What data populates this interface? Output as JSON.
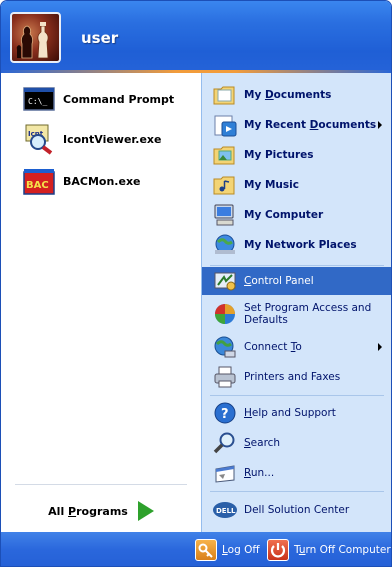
{
  "header": {
    "username": "user"
  },
  "pinned": [
    {
      "label": "Command Prompt",
      "icon": "command-prompt-icon"
    },
    {
      "label": "IcontViewer.exe",
      "icon": "icontviewer-icon"
    },
    {
      "label": "BACMon.exe",
      "icon": "bacmon-icon"
    }
  ],
  "all_programs": {
    "label_pre": "All ",
    "label_u": "P",
    "label_post": "rograms"
  },
  "places": [
    {
      "pre": "My ",
      "u": "D",
      "post": "ocuments",
      "icon": "my-documents-icon",
      "bold": true
    },
    {
      "pre": "My Recent ",
      "u": "D",
      "post": "ocuments",
      "icon": "recent-documents-icon",
      "bold": true,
      "submenu": true
    },
    {
      "pre": "My Pictures",
      "u": "",
      "post": "",
      "icon": "my-pictures-icon",
      "bold": true
    },
    {
      "pre": "My Music",
      "u": "",
      "post": "",
      "icon": "my-music-icon",
      "bold": true
    },
    {
      "pre": "My Computer",
      "u": "",
      "post": "",
      "icon": "my-computer-icon",
      "bold": true
    },
    {
      "pre": "My Network Places",
      "u": "",
      "post": "",
      "icon": "network-places-icon",
      "bold": true
    }
  ],
  "system": [
    {
      "pre": "",
      "u": "C",
      "post": "ontrol Panel",
      "icon": "control-panel-icon",
      "selected": true
    },
    {
      "line1": "Set Program Access and",
      "line2": "Defaults",
      "icon": "program-access-icon"
    },
    {
      "pre": "Connect ",
      "u": "T",
      "post": "o",
      "icon": "connect-to-icon",
      "submenu": true
    },
    {
      "pre": "Printers and Faxes",
      "u": "",
      "post": "",
      "icon": "printers-icon"
    }
  ],
  "help": [
    {
      "pre": "",
      "u": "H",
      "post": "elp and Support",
      "icon": "help-icon"
    },
    {
      "pre": "",
      "u": "S",
      "post": "earch",
      "icon": "search-icon"
    },
    {
      "pre": "",
      "u": "R",
      "post": "un...",
      "icon": "run-icon"
    }
  ],
  "extra": {
    "label": "Dell Solution Center",
    "icon_text": "DELL"
  },
  "footer": {
    "logoff": {
      "pre": "",
      "u": "L",
      "post": "og Off"
    },
    "turnoff": {
      "pre": "T",
      "u": "u",
      "post": "rn Off Computer"
    }
  }
}
